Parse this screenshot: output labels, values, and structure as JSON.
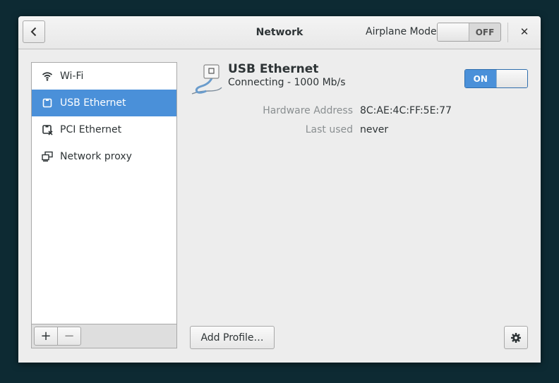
{
  "window": {
    "title": "Network"
  },
  "header": {
    "back_icon": "chevron-left-icon",
    "airplane_mode_label": "Airplane Mode",
    "airplane_mode_state": "OFF",
    "close_label": "✕"
  },
  "sidebar": {
    "items": [
      {
        "label": "Wi-Fi",
        "icon": "wifi-icon"
      },
      {
        "label": "USB Ethernet",
        "icon": "ethernet-icon",
        "selected": true
      },
      {
        "label": "PCI Ethernet",
        "icon": "ethernet-disconnected-icon"
      },
      {
        "label": "Network proxy",
        "icon": "network-proxy-icon"
      }
    ],
    "add_label": "+",
    "remove_label": "−"
  },
  "device": {
    "name": "USB Ethernet",
    "status": "Connecting - 1000 Mb/s",
    "toggle_state": "ON",
    "details": [
      {
        "label": "Hardware Address",
        "value": "8C:AE:4C:FF:5E:77"
      },
      {
        "label": "Last used",
        "value": "never"
      }
    ]
  },
  "footer": {
    "add_profile_label": "Add Profile…",
    "settings_icon": "gear-icon"
  },
  "colors": {
    "accent": "#4a90d9",
    "desktop_background": "#0d2a33",
    "window_background": "#ededed"
  }
}
